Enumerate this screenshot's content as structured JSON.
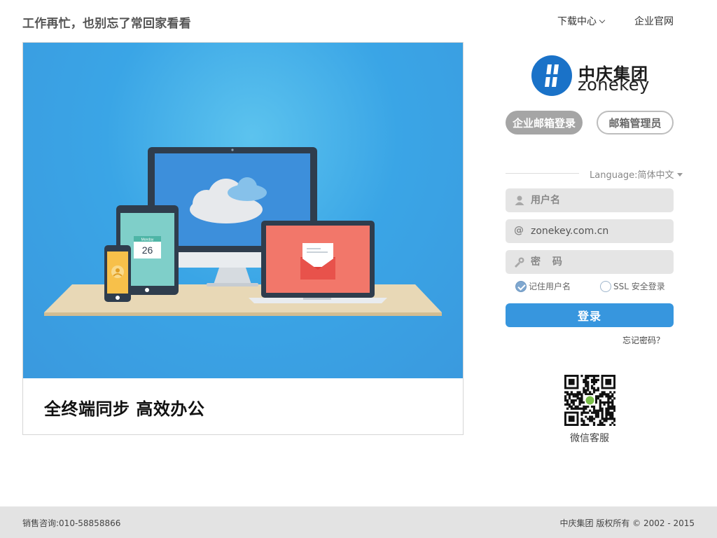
{
  "header": {
    "slogan": "工作再忙，也别忘了常回家看看",
    "nav_download": "下载中心",
    "nav_official": "企业官网"
  },
  "hero": {
    "caption": "全终端同步 高效办公",
    "calendar_day": "26",
    "calendar_month": "Monday"
  },
  "logo": {
    "cn": "中庆集团",
    "en": "zonekey"
  },
  "login": {
    "tab_enterprise": "企业邮箱登录",
    "tab_admin": "邮箱管理员",
    "language_label": "Language:简体中文",
    "username_placeholder": "用户名",
    "domain_value": "zonekey.com.cn",
    "password_placeholder": "密 码",
    "remember_label": "记住用户名",
    "ssl_label": "SSL 安全登录",
    "remember_checked": true,
    "ssl_checked": false,
    "submit_label": "登录",
    "forgot_label": "忘记密码？"
  },
  "qr": {
    "label": "微信客服"
  },
  "footer": {
    "sales": "销售咨询:010-58858866",
    "copyright": "中庆集团 版权所有 © 2002 - 2015"
  },
  "colors": {
    "primary_blue": "#3796de",
    "hero_blue": "#3a9ee2",
    "tab_active_gray": "#a5a5a5",
    "field_bg": "#e5e5e5",
    "footer_bg": "#e3e3e3"
  }
}
